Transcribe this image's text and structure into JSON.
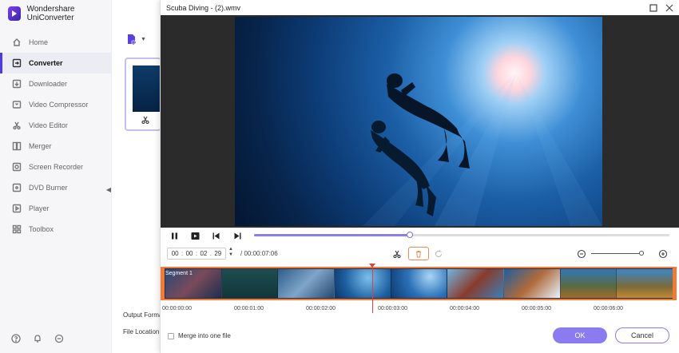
{
  "app": {
    "name": "Wondershare UniConverter",
    "brand_color": "#5b2fd9"
  },
  "sidebar": {
    "items": [
      {
        "label": "Home",
        "icon": "home-icon",
        "active": false
      },
      {
        "label": "Converter",
        "icon": "converter-icon",
        "active": true
      },
      {
        "label": "Downloader",
        "icon": "download-icon",
        "active": false
      },
      {
        "label": "Video Compressor",
        "icon": "compress-icon",
        "active": false
      },
      {
        "label": "Video Editor",
        "icon": "scissors-icon",
        "active": false
      },
      {
        "label": "Merger",
        "icon": "merge-icon",
        "active": false
      },
      {
        "label": "Screen Recorder",
        "icon": "record-icon",
        "active": false
      },
      {
        "label": "DVD Burner",
        "icon": "disc-icon",
        "active": false
      },
      {
        "label": "Player",
        "icon": "play-icon",
        "active": false
      },
      {
        "label": "Toolbox",
        "icon": "grid-icon",
        "active": false
      }
    ],
    "bottom_icons": [
      "help-icon",
      "bell-icon",
      "feedback-icon"
    ]
  },
  "main": {
    "output_format_label": "Output Format:",
    "file_location_label": "File Location:"
  },
  "dialog": {
    "title": "Scuba Diving - (2).wmv",
    "accent_color": "#8b7bf0",
    "playback_progress": 0.375,
    "time": {
      "hh": "00",
      "mm": "00",
      "ss": "02",
      "ff": "29"
    },
    "duration": "/ 00:00:07:06",
    "zoom_level": 0.95,
    "segment_label": "Segment 1",
    "playhead_position": 0.41,
    "ruler": [
      "00:00:00:00",
      "00:00:01:00",
      "00:00:02:00",
      "00:00:03:00",
      "00:00:04:00",
      "00:00:05:00",
      "00:00:06:00"
    ],
    "merge_label": "Merge into one file",
    "ok_label": "OK",
    "cancel_label": "Cancel",
    "timeline_color": "#f07a36"
  }
}
